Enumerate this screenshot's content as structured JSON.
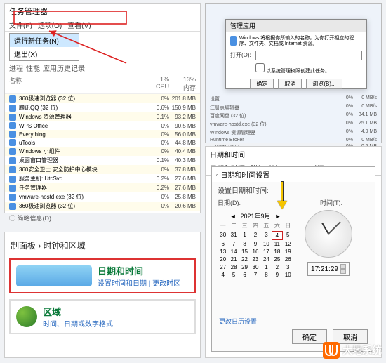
{
  "task_manager": {
    "title": "任务管理器",
    "menu": {
      "file": "文件(F)",
      "options": "选项(O)",
      "view": "查看(V)"
    },
    "submenu": {
      "new_task": "运行新任务(N)",
      "exit": "退出(X)"
    },
    "tabs": [
      "进程",
      "性能",
      "应用历史记录"
    ],
    "head": {
      "name": "名称",
      "cpu_pct": "1%",
      "cpu": "CPU",
      "mem_pct": "13%",
      "mem": "内存"
    },
    "rows": [
      {
        "name": "360极速浏览器 (32 位)",
        "pc": "0%",
        "mm": "201.8 MB"
      },
      {
        "name": "腾讯QQ (32 位)",
        "pc": "0.6%",
        "mm": "150.9 MB"
      },
      {
        "name": "Windows 资源管理器",
        "pc": "0.1%",
        "mm": "93.2 MB"
      },
      {
        "name": "WPS Office",
        "pc": "0%",
        "mm": "90.5 MB"
      },
      {
        "name": "Everything",
        "pc": "0%",
        "mm": "56.0 MB"
      },
      {
        "name": "uTools",
        "pc": "0%",
        "mm": "44.8 MB"
      },
      {
        "name": "Windows 小组件",
        "pc": "0%",
        "mm": "40.4 MB"
      },
      {
        "name": "桌面窗口管理器",
        "pc": "0.1%",
        "mm": "40.3 MB"
      },
      {
        "name": "360安全卫士 安全防护中心模块",
        "pc": "0%",
        "mm": "37.8 MB"
      },
      {
        "name": "服务主机: UtcSvc",
        "pc": "0.2%",
        "mm": "27.6 MB"
      },
      {
        "name": "任务管理器",
        "pc": "0.2%",
        "mm": "27.6 MB"
      },
      {
        "name": "vmware-hostd.exe (32 位)",
        "pc": "0%",
        "mm": "25.8 MB"
      },
      {
        "name": "360极速浏览器 (32 位)",
        "pc": "0%",
        "mm": "20.6 MB"
      }
    ],
    "footer": "简略信息(D)"
  },
  "right_panel": {
    "dialog_title": "管理应用",
    "msg": "Windows 将根据你所输入的名称，为你打开相应的程序、文件夹、文档或 Internet 资源。",
    "open_label": "打开(O):",
    "open_value": "",
    "admin_check": "以系统管理权限创建此任务。",
    "ok": "确定",
    "cancel": "取消",
    "browse": "浏览(B)...",
    "rows": [
      {
        "n": "设置",
        "v1": "0%",
        "v2": "0 MB/s"
      },
      {
        "n": "注册表编辑器",
        "v1": "0%",
        "v2": "0 MB/s"
      },
      {
        "n": "百度网盘 (32 位)",
        "v1": "0%",
        "v2": "34.1 MB"
      },
      {
        "n": "vmware-hostd.exe (32 位)",
        "v1": "0%",
        "v2": "25.1 MB"
      },
      {
        "n": "Windows 资源管理器",
        "v1": "0%",
        "v2": "4.9 MB"
      },
      {
        "n": "Runtime Broker",
        "v1": "0%",
        "v2": "0 MB/s"
      },
      {
        "n": "远程过程调用",
        "v1": "0%",
        "v2": "0.6 MB"
      }
    ]
  },
  "control_panel": {
    "breadcrumb": "制面板 › 时钟和区域",
    "date_time": {
      "title": "日期和时间",
      "sub": "设置时间和日期  |  更改时区"
    },
    "region": {
      "title": "区域",
      "sub": "时间、日期或数字格式"
    }
  },
  "datetime": {
    "heading": "日期和时间",
    "tabs": [
      "日期和时间",
      "附加时钟",
      "Internet 时间"
    ],
    "dialog_title": "日期和时间设置",
    "set_label": "设置日期和时间:",
    "date_col": "日期(D):",
    "time_col": "时间(T):",
    "month": "2021年9月",
    "prev": "◄",
    "next": "►",
    "dows": [
      "一",
      "二",
      "三",
      "四",
      "五",
      "六",
      "日"
    ],
    "weeks": [
      [
        "30",
        "31",
        "1",
        "2",
        "3",
        "4",
        "5"
      ],
      [
        "6",
        "7",
        "8",
        "9",
        "10",
        "11",
        "12"
      ],
      [
        "13",
        "14",
        "15",
        "16",
        "17",
        "18",
        "19"
      ],
      [
        "20",
        "21",
        "22",
        "23",
        "24",
        "25",
        "26"
      ],
      [
        "27",
        "28",
        "29",
        "30",
        "1",
        "2",
        "3"
      ],
      [
        "4",
        "5",
        "6",
        "7",
        "8",
        "9",
        "10"
      ]
    ],
    "selected_day": "4",
    "time_value": "17:21:29",
    "change_cal": "更改日历设置",
    "ok": "确定",
    "cancel": "取消"
  },
  "watermark": {
    "text": "大地系统"
  }
}
